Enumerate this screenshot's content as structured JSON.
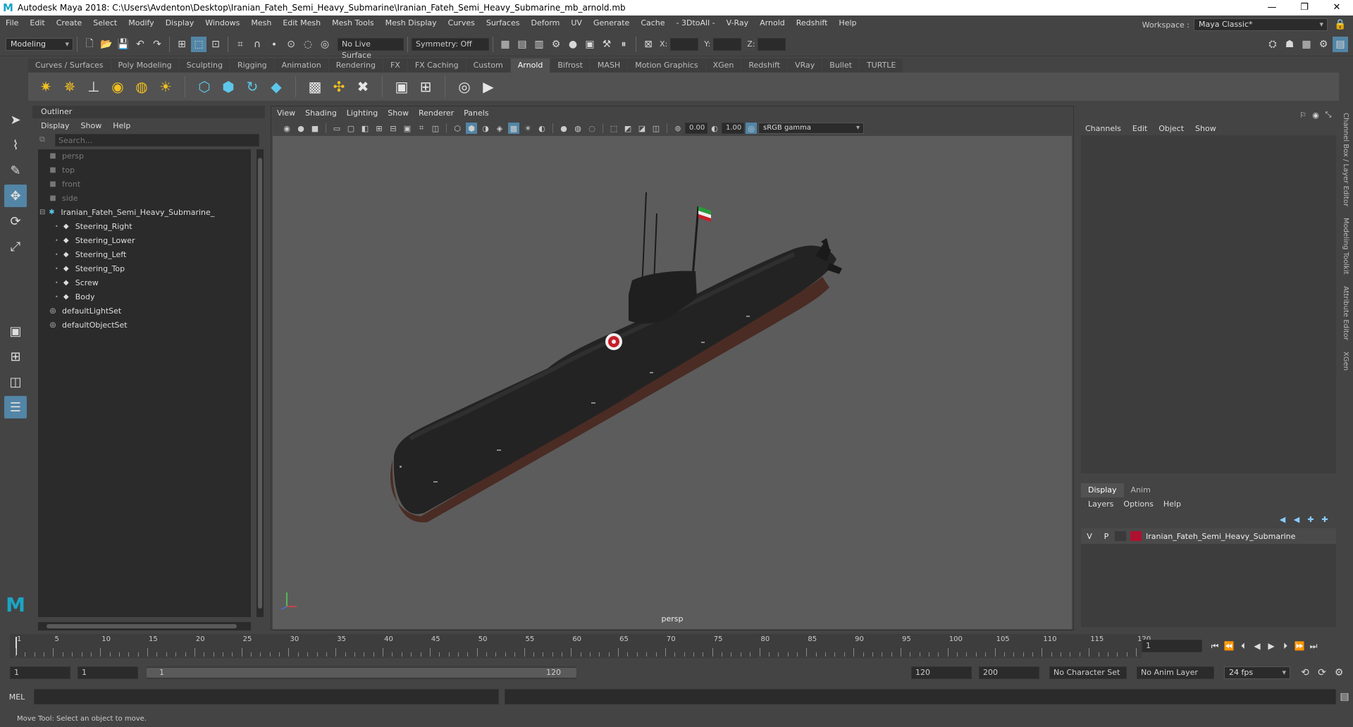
{
  "window": {
    "title": "Autodesk Maya 2018: C:\\Users\\Avdenton\\Desktop\\Iranian_Fateh_Semi_Heavy_Submarine\\Iranian_Fateh_Semi_Heavy_Submarine_mb_arnold.mb",
    "minimize": "—",
    "maximize": "❐",
    "close": "✕"
  },
  "menu": [
    "File",
    "Edit",
    "Create",
    "Select",
    "Modify",
    "Display",
    "Windows",
    "Mesh",
    "Edit Mesh",
    "Mesh Tools",
    "Mesh Display",
    "Curves",
    "Surfaces",
    "Deform",
    "UV",
    "Generate",
    "Cache",
    "- 3DtoAll -",
    "V-Ray",
    "Arnold",
    "Redshift",
    "Help"
  ],
  "workspace": {
    "label": "Workspace :",
    "value": "Maya Classic*"
  },
  "statusline": {
    "mode": "Modeling",
    "live_surface": "No Live Surface",
    "symmetry": "Symmetry: Off",
    "x_label": "X:",
    "y_label": "Y:",
    "z_label": "Z:"
  },
  "shelf_tabs": [
    "Curves / Surfaces",
    "Poly Modeling",
    "Sculpting",
    "Rigging",
    "Animation",
    "Rendering",
    "FX",
    "FX Caching",
    "Custom",
    "Arnold",
    "Bifrost",
    "MASH",
    "Motion Graphics",
    "XGen",
    "Redshift",
    "VRay",
    "Bullet",
    "TURTLE"
  ],
  "shelf_active": "Arnold",
  "outliner": {
    "title": "Outliner",
    "menu": [
      "Display",
      "Show",
      "Help"
    ],
    "search_placeholder": "Search...",
    "items": [
      {
        "label": "persp",
        "type": "camera",
        "indent": 0,
        "dim": true
      },
      {
        "label": "top",
        "type": "camera",
        "indent": 0,
        "dim": true
      },
      {
        "label": "front",
        "type": "camera",
        "indent": 0,
        "dim": true
      },
      {
        "label": "side",
        "type": "camera",
        "indent": 0,
        "dim": true
      },
      {
        "label": "Iranian_Fateh_Semi_Heavy_Submarine_",
        "type": "group",
        "indent": 0,
        "dim": false
      },
      {
        "label": "Steering_Right",
        "type": "mesh",
        "indent": 1,
        "dim": false
      },
      {
        "label": "Steering_Lower",
        "type": "mesh",
        "indent": 1,
        "dim": false
      },
      {
        "label": "Steering_Left",
        "type": "mesh",
        "indent": 1,
        "dim": false
      },
      {
        "label": "Steering_Top",
        "type": "mesh",
        "indent": 1,
        "dim": false
      },
      {
        "label": "Screw",
        "type": "mesh",
        "indent": 1,
        "dim": false
      },
      {
        "label": "Body",
        "type": "mesh",
        "indent": 1,
        "dim": false
      },
      {
        "label": "defaultLightSet",
        "type": "set",
        "indent": 0,
        "dim": false
      },
      {
        "label": "defaultObjectSet",
        "type": "set",
        "indent": 0,
        "dim": false
      }
    ]
  },
  "viewport": {
    "menu": [
      "View",
      "Shading",
      "Lighting",
      "Show",
      "Renderer",
      "Panels"
    ],
    "exposure": "0.00",
    "gamma": "1.00",
    "color_space": "sRGB gamma",
    "camera_label": "persp"
  },
  "channelbox": {
    "menu": [
      "Channels",
      "Edit",
      "Object",
      "Show"
    ],
    "layer_tabs": [
      "Display",
      "Anim"
    ],
    "layer_menu": [
      "Layers",
      "Options",
      "Help"
    ],
    "layer": {
      "v": "V",
      "p": "P",
      "name": "Iranian_Fateh_Semi_Heavy_Submarine",
      "color": "#b01030"
    }
  },
  "side_tabs": [
    "Channel Box / Layer Editor",
    "Modeling Toolkit",
    "Attribute Editor",
    "XGen"
  ],
  "timeline": {
    "ticks": [
      "1",
      "5",
      "10",
      "15",
      "20",
      "25",
      "30",
      "35",
      "40",
      "45",
      "50",
      "55",
      "60",
      "65",
      "70",
      "75",
      "80",
      "85",
      "90",
      "95",
      "100",
      "105",
      "110",
      "115",
      "120"
    ],
    "current_frame": "1"
  },
  "range": {
    "start": "1",
    "playback_start": "1",
    "slider_start": "1",
    "slider_end": "120",
    "playback_end": "120",
    "end": "200",
    "character_set": "No Character Set",
    "anim_layer": "No Anim Layer",
    "fps": "24 fps"
  },
  "command": {
    "label": "MEL"
  },
  "helpline": {
    "text": "Move Tool: Select an object to move."
  }
}
